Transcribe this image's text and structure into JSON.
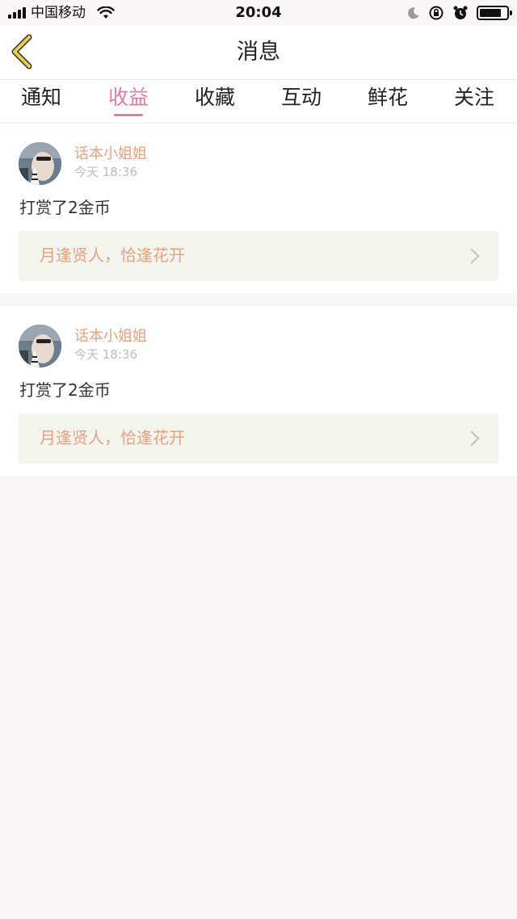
{
  "status_bar": {
    "carrier": "中国移动",
    "time": "20:04"
  },
  "nav": {
    "title": "消息"
  },
  "tabs": [
    {
      "label": "通知",
      "active": false
    },
    {
      "label": "收益",
      "active": true
    },
    {
      "label": "收藏",
      "active": false
    },
    {
      "label": "互动",
      "active": false
    },
    {
      "label": "鲜花",
      "active": false
    },
    {
      "label": "关注",
      "active": false
    }
  ],
  "messages": [
    {
      "username": "话本小姐姐",
      "time": "今天 18:36",
      "text": "打赏了2金币",
      "quote": "月逢贤人，恰逢花开"
    },
    {
      "username": "话本小姐姐",
      "time": "今天 18:36",
      "text": "打赏了2金币",
      "quote": "月逢贤人，恰逢花开"
    }
  ],
  "colors": {
    "accent": "#e678a6",
    "username": "#e9a07d",
    "back_icon": "#e8d24a",
    "page_bg": "#f7f5f5",
    "quote_bg": "#f4f4ee"
  }
}
